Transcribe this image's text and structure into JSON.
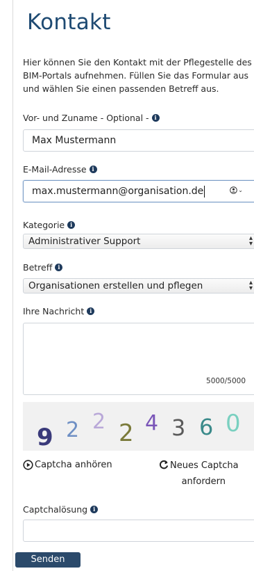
{
  "page": {
    "title": "Kontakt",
    "intro": "Hier können Sie den Kontakt mit der Pflegestelle des BIM-Portals aufnehmen. Füllen Sie das Formular aus und wählen Sie einen passenden Betreff aus."
  },
  "form": {
    "name": {
      "label": "Vor- und Zuname - Optional -",
      "value": "Max Mustermann"
    },
    "email": {
      "label": "E-Mail-Adresse",
      "value": "max.mustermann@organisation.de"
    },
    "category": {
      "label": "Kategorie",
      "value": "Administrativer Support"
    },
    "subject": {
      "label": "Betreff",
      "value": "Organisationen erstellen und pflegen"
    },
    "message": {
      "label": "Ihre Nachricht",
      "value": "",
      "counter": "5000/5000"
    },
    "captcha": {
      "code": "92224360",
      "colors": [
        "#3a3a7a",
        "#6e8fc4",
        "#b9a8d8",
        "#7a7a3a",
        "#7a55b8",
        "#5a5a5a",
        "#3a8a8a",
        "#7ad0c0"
      ],
      "audio_label": "Captcha anhören",
      "new_label_line1": "Neues Captcha",
      "new_label_line2": "anfordern",
      "solution_label": "Captchalösung",
      "solution_value": ""
    },
    "submit_label": "Senden"
  },
  "icons": {
    "info": "info-icon",
    "play": "play-circle-icon",
    "refresh": "refresh-icon",
    "password-manager": "key-person-icon"
  }
}
